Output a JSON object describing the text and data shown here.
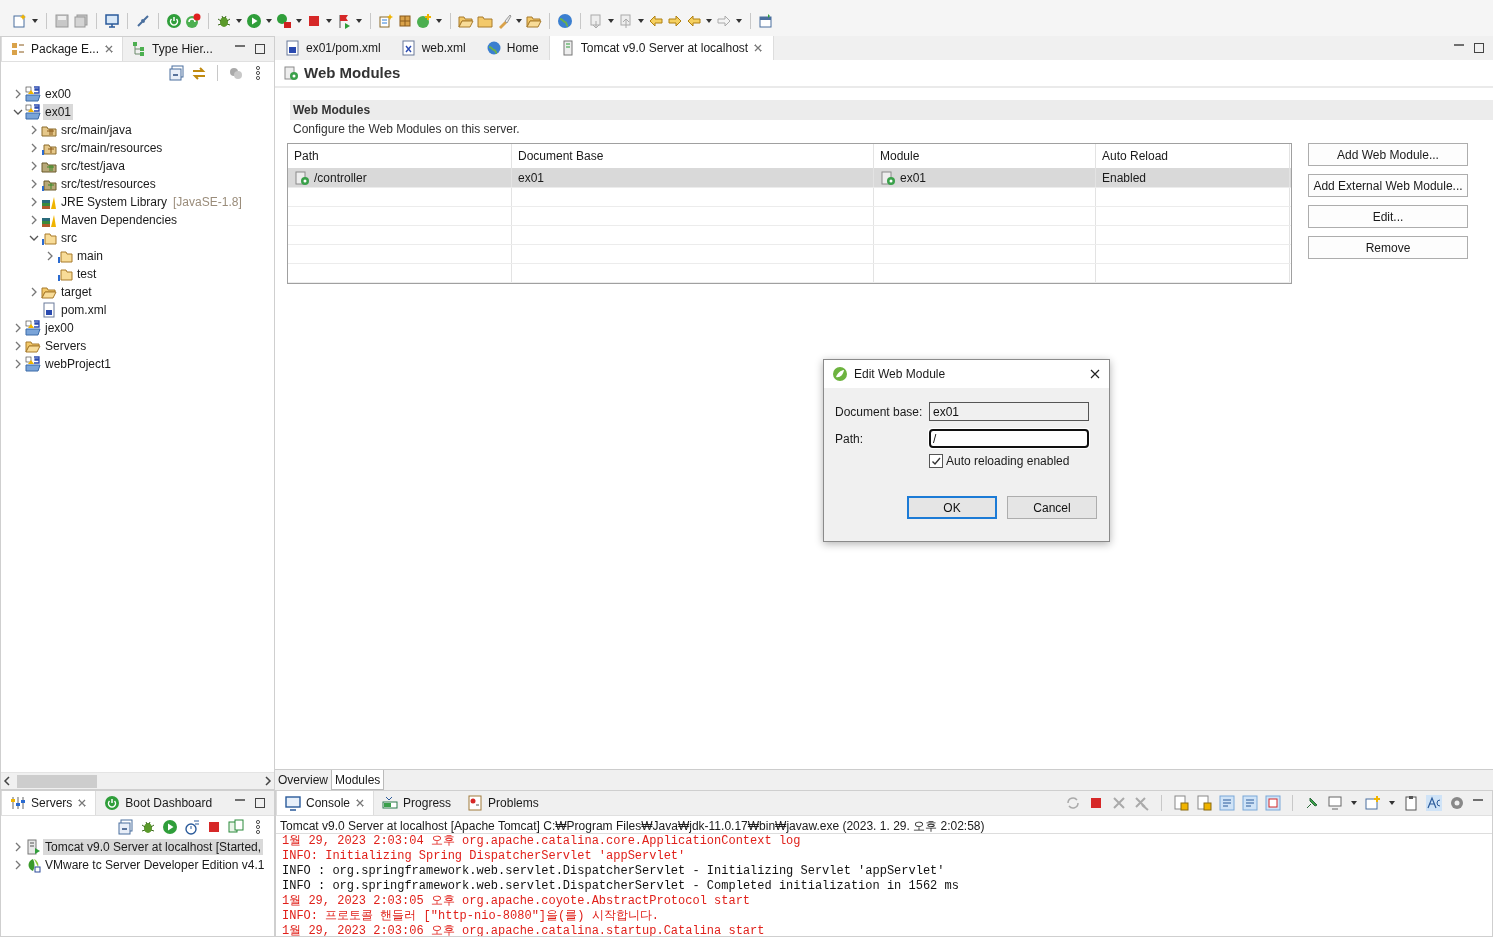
{
  "package_explorer": {
    "tabs": [
      {
        "label": "Package E...",
        "kind": "package",
        "selected": true,
        "closable": true
      },
      {
        "label": "Type Hier...",
        "kind": "hierarchy",
        "selected": false,
        "closable": false
      }
    ],
    "tree": [
      {
        "label": "ex00",
        "kind": "project",
        "expanded": false,
        "selected": false
      },
      {
        "label": "ex01",
        "kind": "project",
        "expanded": true,
        "selected": true,
        "children": [
          {
            "label": "src/main/java",
            "kind": "source_folder",
            "expanded": false,
            "selected": false
          },
          {
            "label": "src/main/resources",
            "kind": "resource_folder",
            "expanded": false,
            "selected": false
          },
          {
            "label": "src/test/java",
            "kind": "test_folder",
            "expanded": false,
            "selected": false
          },
          {
            "label": "src/test/resources",
            "kind": "test_resource_folder",
            "expanded": false,
            "selected": false
          },
          {
            "label": "JRE System Library",
            "suffix": "[JavaSE-1.8]",
            "kind": "library",
            "expanded": false,
            "selected": false
          },
          {
            "label": "Maven Dependencies",
            "kind": "library",
            "expanded": false,
            "selected": false
          },
          {
            "label": "src",
            "kind": "info_folder",
            "expanded": true,
            "selected": false,
            "children": [
              {
                "label": "main",
                "kind": "info_folder",
                "expanded": false,
                "selected": false
              },
              {
                "label": "test",
                "kind": "info_folder",
                "selected": false
              }
            ]
          },
          {
            "label": "target",
            "kind": "folder",
            "expanded": false,
            "selected": false
          },
          {
            "label": "pom.xml",
            "kind": "file",
            "selected": false
          }
        ]
      },
      {
        "label": "jex00",
        "kind": "project",
        "expanded": false,
        "selected": false
      },
      {
        "label": "Servers",
        "kind": "folder",
        "expanded": false,
        "selected": false
      },
      {
        "label": "webProject1",
        "kind": "project",
        "expanded": false,
        "selected": false
      }
    ]
  },
  "editor": {
    "tabs": [
      {
        "label": "ex01/pom.xml",
        "kind": "maven",
        "selected": false,
        "closable": false
      },
      {
        "label": "web.xml",
        "kind": "xml",
        "selected": false,
        "closable": false
      },
      {
        "label": "Home",
        "kind": "web",
        "selected": false,
        "closable": false
      },
      {
        "label": "Tomcat v9.0 Server at localhost",
        "kind": "server",
        "selected": true,
        "closable": true
      }
    ],
    "page_title": "Web Modules",
    "section": {
      "title": "Web Modules",
      "description": "Configure the Web Modules on this server."
    },
    "table": {
      "columns": [
        "Path",
        "Document Base",
        "Module",
        "Auto Reload"
      ],
      "rows": [
        {
          "cells": [
            "/controller",
            "ex01",
            "ex01",
            "Enabled"
          ],
          "selected": true
        }
      ]
    },
    "buttons": [
      "Add Web Module...",
      "Add External Web Module...",
      "Edit...",
      "Remove"
    ],
    "bottom_tabs": [
      {
        "label": "Overview",
        "selected": false
      },
      {
        "label": "Modules",
        "selected": true
      }
    ]
  },
  "dialog": {
    "title": "Edit Web Module",
    "fields": [
      {
        "label": "Document base:",
        "value": "ex01",
        "read_only": true,
        "focused": false
      },
      {
        "label": "Path:",
        "value": "/",
        "read_only": false,
        "focused": true
      }
    ],
    "checkbox": {
      "label": "Auto reloading enabled",
      "checked": true
    },
    "buttons": [
      {
        "label": "OK",
        "default": true
      },
      {
        "label": "Cancel",
        "default": false
      }
    ]
  },
  "servers_panel": {
    "tabs": [
      {
        "label": "Servers",
        "kind": "servers",
        "selected": true,
        "closable": true
      },
      {
        "label": "Boot Dashboard",
        "kind": "boot",
        "selected": false,
        "closable": false
      }
    ],
    "tree": [
      {
        "label": "Tomcat v9.0 Server at localhost  [Started,",
        "kind": "tomcat",
        "expanded": false,
        "selected": true
      },
      {
        "label": "VMware tc Server Developer Edition v4.1",
        "kind": "vmware",
        "expanded": false,
        "selected": false
      }
    ]
  },
  "console": {
    "tabs": [
      {
        "label": "Console",
        "kind": "console",
        "selected": true,
        "closable": true
      },
      {
        "label": "Progress",
        "kind": "progress",
        "selected": false,
        "closable": false
      },
      {
        "label": "Problems",
        "kind": "problems",
        "selected": false,
        "closable": false
      }
    ],
    "header": "Tomcat v9.0 Server at localhost [Apache Tomcat] C:₩Program Files₩Java₩jdk-11.0.17₩bin₩javaw.exe  (2023. 1. 29. 오후 2:02:58)",
    "lines": [
      {
        "text": "1월 29, 2023 2:03:04 오후 org.apache.catalina.core.ApplicationContext log",
        "kind": "err"
      },
      {
        "text": "INFO: Initializing Spring DispatcherServlet 'appServlet'",
        "kind": "err"
      },
      {
        "text": "INFO : org.springframework.web.servlet.DispatcherServlet - Initializing Servlet 'appServlet'",
        "kind": "out"
      },
      {
        "text": "INFO : org.springframework.web.servlet.DispatcherServlet - Completed initialization in 1562 ms",
        "kind": "out"
      },
      {
        "text": "1월 29, 2023 2:03:05 오후 org.apache.coyote.AbstractProtocol start",
        "kind": "err"
      },
      {
        "text": "INFO: 프로토콜 핸들러 [\"http-nio-8080\"]을(를) 시작합니다.",
        "kind": "err"
      },
      {
        "text": "1월 29, 2023 2:03:06 오후 org.apache.catalina.startup.Catalina start",
        "kind": "err"
      }
    ]
  }
}
